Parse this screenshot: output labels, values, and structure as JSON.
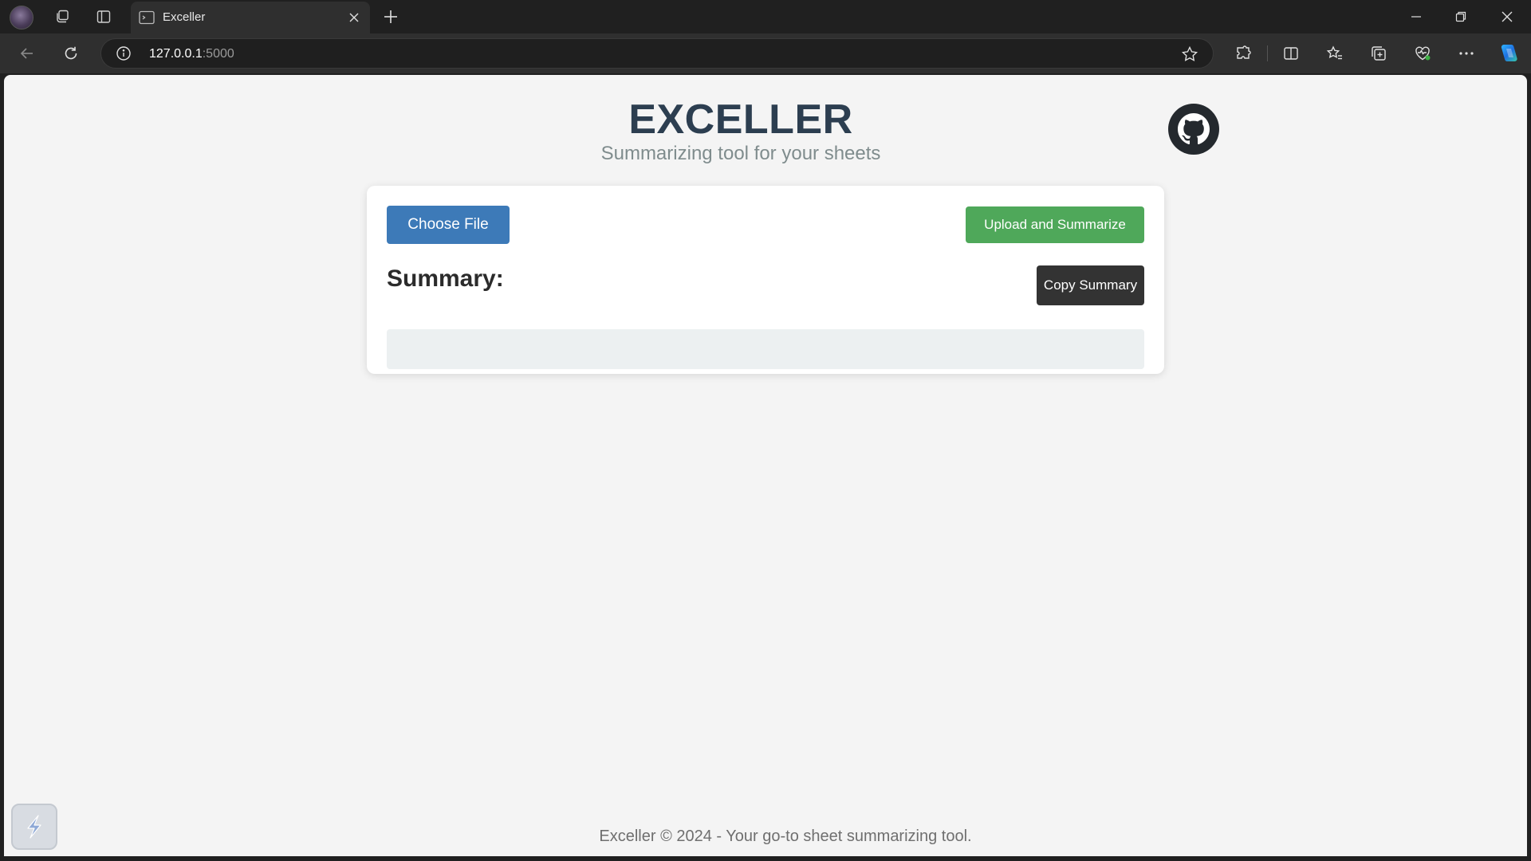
{
  "browser": {
    "tab_title": "Exceller",
    "url_host": "127.0.0.1",
    "url_port": ":5000",
    "icons": [
      "profile-avatar",
      "workspaces-icon",
      "vertical-tabs-icon",
      "close-icon",
      "plus-icon",
      "back-icon",
      "refresh-icon",
      "info-icon",
      "star-icon",
      "extensions-icon",
      "split-screen-icon",
      "favorites-icon",
      "collections-icon",
      "browser-essentials-icon",
      "more-icon",
      "copilot-icon"
    ]
  },
  "page": {
    "title": "EXCELLER",
    "subtitle": "Summarizing tool for your sheets",
    "choose_file_label": "Choose File",
    "upload_label": "Upload and Summarize",
    "summary_heading": "Summary:",
    "copy_label": "Copy Summary",
    "summary_text": "",
    "footer": "Exceller © 2024 - Your go-to sheet summarizing tool."
  },
  "colors": {
    "title": "#2c3e50",
    "choose_button": "#3d7ab8",
    "upload_button": "#4fa85a",
    "copy_button": "#333333",
    "summary_box": "#ecf0f1"
  }
}
